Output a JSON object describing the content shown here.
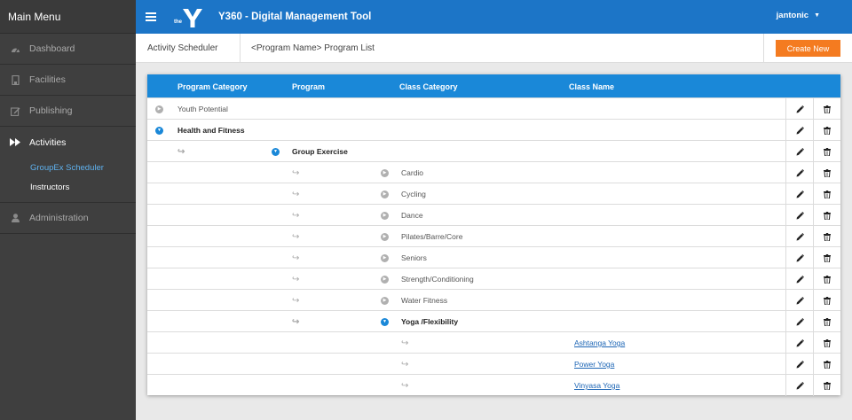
{
  "sidebar": {
    "title": "Main Menu",
    "items": [
      {
        "label": "Dashboard",
        "icon": "dashboard-icon"
      },
      {
        "label": "Facilities",
        "icon": "building-icon"
      },
      {
        "label": "Publishing",
        "icon": "edit-icon"
      },
      {
        "label": "Activities",
        "icon": "fast-forward-icon"
      },
      {
        "label": "Administration",
        "icon": "user-icon"
      }
    ],
    "sub_items": [
      {
        "label": "GroupEx Scheduler"
      },
      {
        "label": "Instructors"
      }
    ]
  },
  "topbar": {
    "logo_prefix": "the",
    "title": "Y360 - Digital Management Tool",
    "user": "jantonic"
  },
  "breadcrumb": {
    "section": "Activity Scheduler",
    "page": "<Program Name> Program List",
    "create_label": "Create New"
  },
  "table": {
    "headers": {
      "program_category": "Program Category",
      "program": "Program",
      "class_category": "Class Category",
      "class_name": "Class Name"
    },
    "rows": [
      {
        "text": "Youth Potential",
        "level": 0,
        "toggle": "closed",
        "bold": false,
        "link": false
      },
      {
        "text": "Health and Fitness",
        "level": 0,
        "toggle": "open",
        "bold": true,
        "link": false
      },
      {
        "text": "Group Exercise",
        "level": 1,
        "toggle": "open",
        "bold": true,
        "link": false
      },
      {
        "text": "Cardio",
        "level": 2,
        "toggle": "closed",
        "bold": false,
        "link": false
      },
      {
        "text": "Cycling",
        "level": 2,
        "toggle": "closed",
        "bold": false,
        "link": false
      },
      {
        "text": "Dance",
        "level": 2,
        "toggle": "closed",
        "bold": false,
        "link": false
      },
      {
        "text": "Pilates/Barre/Core",
        "level": 2,
        "toggle": "closed",
        "bold": false,
        "link": false
      },
      {
        "text": "Seniors",
        "level": 2,
        "toggle": "closed",
        "bold": false,
        "link": false
      },
      {
        "text": "Strength/Conditioning",
        "level": 2,
        "toggle": "closed",
        "bold": false,
        "link": false
      },
      {
        "text": "Water Fitness",
        "level": 2,
        "toggle": "closed",
        "bold": false,
        "link": false
      },
      {
        "text": "Yoga /Flexibility",
        "level": 2,
        "toggle": "open",
        "bold": true,
        "link": false
      },
      {
        "text": "Ashtanga Yoga",
        "level": 3,
        "toggle": "none",
        "bold": false,
        "link": true
      },
      {
        "text": "Power Yoga",
        "level": 3,
        "toggle": "none",
        "bold": false,
        "link": true
      },
      {
        "text": "Vinyasa Yoga",
        "level": 3,
        "toggle": "none",
        "bold": false,
        "link": true
      }
    ],
    "indent_arrow": "↪",
    "edit_icon": "pencil-icon",
    "delete_icon": "trash-icon"
  },
  "colors": {
    "sidebar_bg": "#3f3f3f",
    "topbar_bg": "#1c75c7",
    "table_header_bg": "#1a88d8",
    "accent_link": "#5fb2ef",
    "create_button": "#f47b20"
  }
}
